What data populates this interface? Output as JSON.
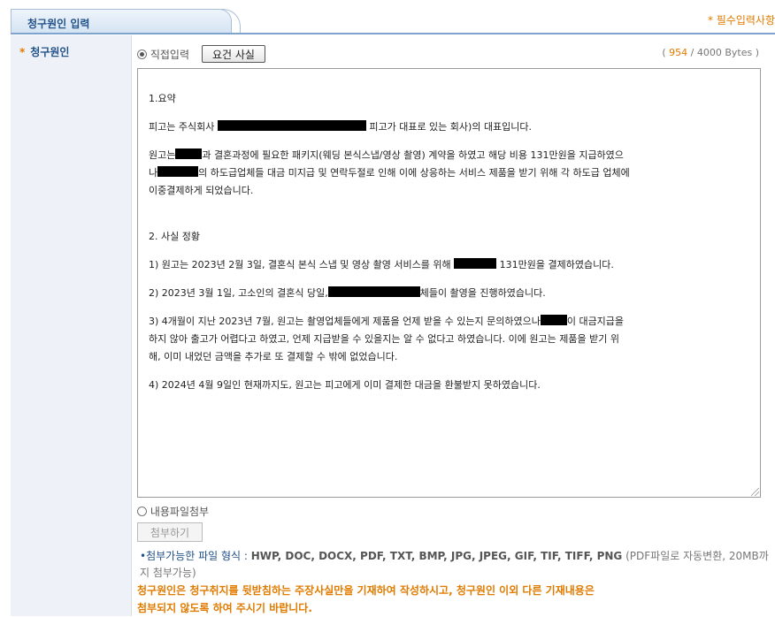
{
  "header": {
    "tab_title": "청구원인 입력",
    "required_note": "* 필수입력사항"
  },
  "field": {
    "star": "*",
    "label": "청구원인"
  },
  "controls": {
    "direct_input_label": "직접입력",
    "facts_button": "요건 사실",
    "bytes_open": "( ",
    "bytes_current": "954",
    "bytes_rest": " / 4000 Bytes )"
  },
  "body": {
    "s1_title": "1.요약",
    "p1_a": "피고는 주식회사",
    "p1_b": "피고가 대표로 있는 회사)의 대표입니다.",
    "p2_a": "원고는",
    "p2_b": "과 결혼과정에 필요한 패키지(웨딩 본식스냅/영상 촬영) 계약을 하였고 해당 비용 131만원을 지급하였으",
    "p2_c": "나",
    "p2_d": "의 하도급업체들 대금 미지급 및 연락두절로 인해 이에 상응하는 서비스 제품을 받기 위해 각 하도급 업체에",
    "p2_e": "이중결제하게 되었습니다.",
    "s2_title": "2. 사실 정황",
    "i1_a": "1) 원고는 2023년 2월 3일, 결혼식 본식 스냅 및 영상 촬영 서비스를 위해",
    "i1_b": "131만원을 결제하였습니다.",
    "i2_a": "2) 2023년 3월 1일, 고소인의 결혼식 당일,",
    "i2_b": "체들이 촬영을 진행하였습니다.",
    "i3_a": "3) 4개월이 지난 2023년 7월, 원고는 촬영업체들에게 제품을 언제 받을 수 있는지 문의하였으나",
    "i3_b": "이 대금지급을",
    "i3_c": "하지 않아 출고가 어렵다고 하였고, 언제 지급받을 수 있을지는 알 수 없다고 하였습니다. 이에 원고는 제품을 받기 위",
    "i3_d": "해, 이미 내었던 금액을 추가로 또 결제할 수 밖에 없었습니다.",
    "i4": "4) 2024년 4월 9일인 현재까지도, 원고는 피고에게 이미 결제한 대금을 환불받지 못하였습니다."
  },
  "attachment": {
    "file_attach_label": "내용파일첨부",
    "attach_button": "첨부하기",
    "formats_label": "첨부가능한 파일 형식 :",
    "formats_list": "HWP, DOC, DOCX, PDF, TXT, BMP, JPG, JPEG, GIF, TIF, TIFF, PNG",
    "formats_note": "(PDF파일로 자동변환, 20MB까지 첨부가능)",
    "warning_line1": "청구원인은 청구취지를 뒷받침하는 주장사실만을 기재하여 작성하시고, 청구원인 이외 다른 기재내용은",
    "warning_line2": "첨부되지 않도록 하여 주시기 바랍니다."
  }
}
